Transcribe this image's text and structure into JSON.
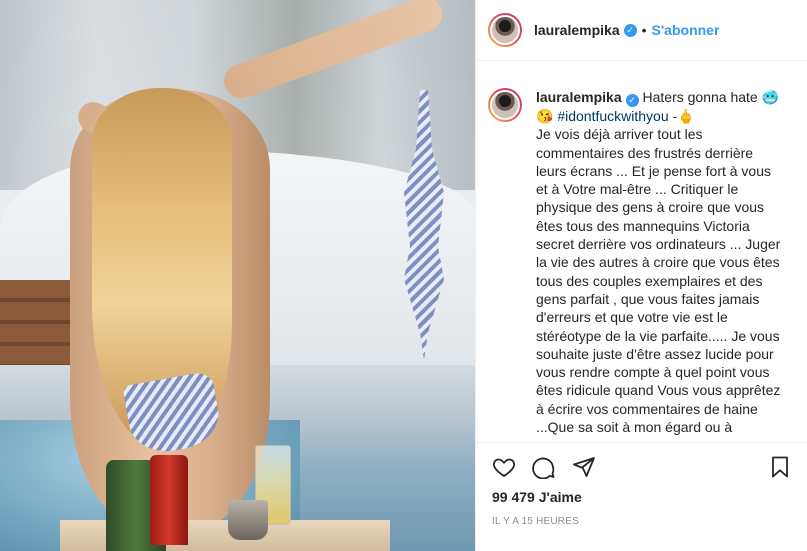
{
  "photo": {
    "alt_subject": "hot-tub-snow-photo"
  },
  "header": {
    "username": "lauralempika",
    "separator": "•",
    "follow_label": "S'abonner"
  },
  "caption": {
    "username": "lauralempika",
    "line1": " Haters gonna hate 🥶",
    "hashtag_emoji": "😘 ",
    "hashtag": "#idontfuckwithyou",
    "hashtag_suffix": " -🖕",
    "body": "Je vois déjà arriver tout les commentaires des frustrés derrière leurs écrans ... Et je pense fort à vous et à Votre mal-être ... Critiquer le physique des gens à croire que vous êtes tous des mannequins Victoria secret derrière vos ordinateurs ... Juger la vie des autres à croire que vous êtes tous des couples exemplaires et des gens parfait , que vous faites jamais d'erreurs et que votre vie est le stéréotype de la vie parfaite..... Je vous souhaite juste d'être assez lucide pour vous rendre compte à quel point vous êtes ridicule quand Vous vous apprêtez à écrire vos commentaires de haine ...Que sa soit à mon égard ou à"
  },
  "actions": {
    "likes": "99 479 J'aime",
    "timestamp": "IL Y A 15 HEURES"
  },
  "icons": {
    "like": "heart-icon",
    "comment": "comment-icon",
    "share": "share-icon",
    "save": "bookmark-icon",
    "verified": "verified-badge-icon"
  },
  "colors": {
    "accent": "#3897f0",
    "hashtag": "#003569",
    "muted": "#8e8e8e"
  }
}
